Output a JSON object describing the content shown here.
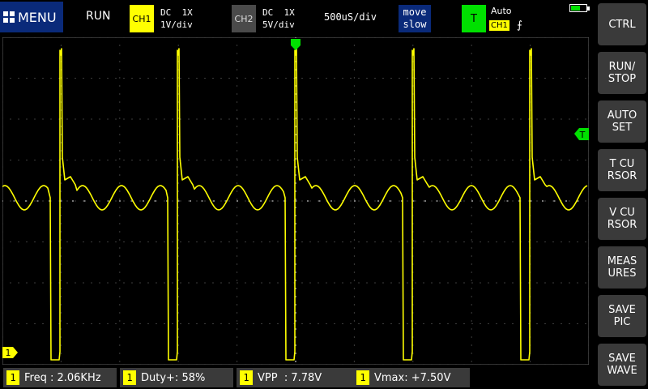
{
  "header": {
    "menu_label": "MENU",
    "run_state": "RUN",
    "ch1": {
      "badge": "CH1",
      "coupling": "DC  1X",
      "scale": "1V/div"
    },
    "ch2": {
      "badge": "CH2",
      "coupling": "DC  1X",
      "scale": "5V/div"
    },
    "timebase": "500uS/div",
    "move_label": "move\nslow",
    "trigger": {
      "badge": "T",
      "mode": "Auto",
      "source": "CH1",
      "edge": "⨍"
    },
    "battery_level": 0.6
  },
  "sidebar": {
    "buttons": [
      {
        "label": "CTRL"
      },
      {
        "label": "RUN/\nSTOP"
      },
      {
        "label": "AUTO\nSET"
      },
      {
        "label": "T CU\nRSOR"
      },
      {
        "label": "V CU\nRSOR"
      },
      {
        "label": "MEAS\nURES"
      },
      {
        "label": "SAVE\nPIC"
      },
      {
        "label": "SAVE\nWAVE"
      }
    ]
  },
  "markers": {
    "trigger_pos_icon": "down-triangle-green",
    "trigger_level_label": "T",
    "ch1_ground_label": "1"
  },
  "measurements": [
    {
      "channel": "1",
      "text": "Freq : 2.06KHz"
    },
    {
      "channel": "1",
      "text": "Duty+: 58%"
    },
    {
      "channel": "1",
      "text": "VPP  : 7.78V"
    },
    {
      "channel": "1",
      "text": "Vmax: +7.50V"
    }
  ],
  "colors": {
    "ch1": "#ffff00",
    "trigger": "#00e000",
    "menu_bg": "#0a2a7a",
    "side_bg": "#3a3a3a"
  }
}
